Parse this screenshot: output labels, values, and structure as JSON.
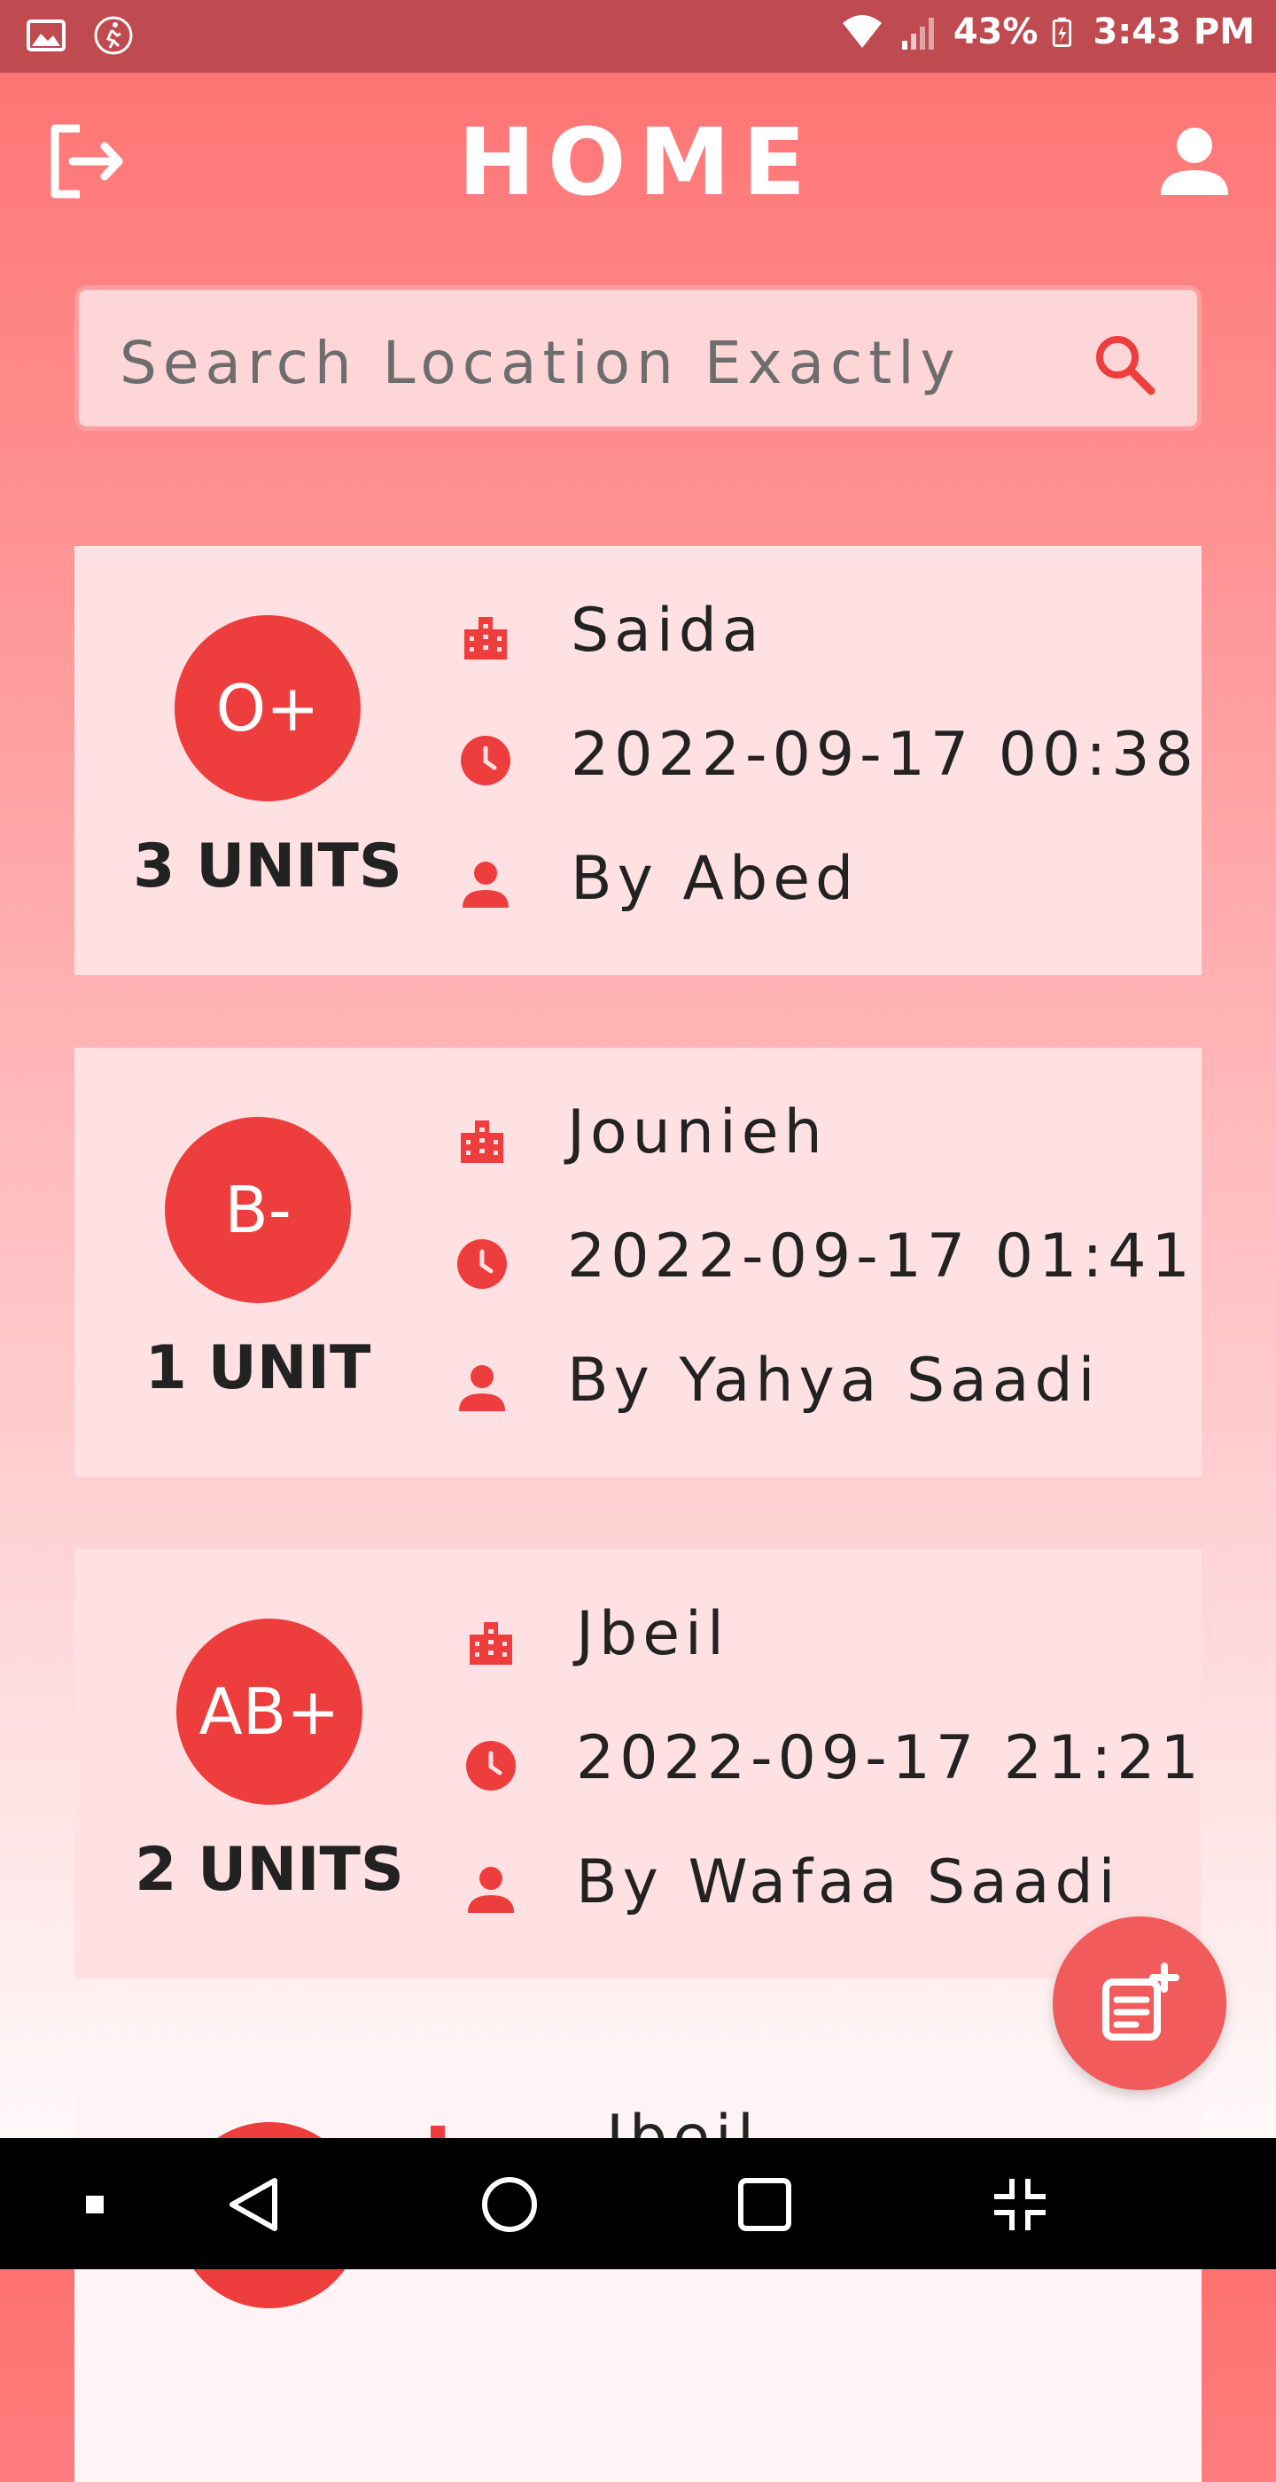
{
  "status_bar": {
    "battery": "43%",
    "time": "3:43 PM",
    "icons": [
      "gallery-icon",
      "activity-icon",
      "wifi-icon",
      "signal-icon",
      "battery-charging-icon"
    ]
  },
  "header": {
    "title": "HOME",
    "logout_icon": "logout-icon",
    "profile_icon": "person-icon"
  },
  "search": {
    "placeholder": "Search Location Exactly",
    "value": "",
    "icon": "search-icon"
  },
  "colors": {
    "accent": "#ee3d3d",
    "status_bar": "#bf4a4f",
    "card": "#ffe1e3",
    "fab": "#f15b5b"
  },
  "requests": [
    {
      "blood_type": "O+",
      "units": "3 UNITS",
      "location": "Saida",
      "datetime": "2022-09-17 00:38",
      "by": "By Abed"
    },
    {
      "blood_type": "B-",
      "units": "1 UNIT",
      "location": "Jounieh",
      "datetime": "2022-09-17 01:41",
      "by": "By Yahya Saadi"
    },
    {
      "blood_type": "AB+",
      "units": "2 UNITS",
      "location": "Jbeil",
      "datetime": "2022-09-17 21:21",
      "by": "By Wafaa Saadi"
    },
    {
      "location": "Jbeil"
    }
  ],
  "fab": {
    "icon": "add-note-icon"
  },
  "nav_bar": {
    "icons": [
      "square-dot-icon",
      "back-icon",
      "home-icon",
      "recents-icon",
      "collapse-icon"
    ]
  }
}
